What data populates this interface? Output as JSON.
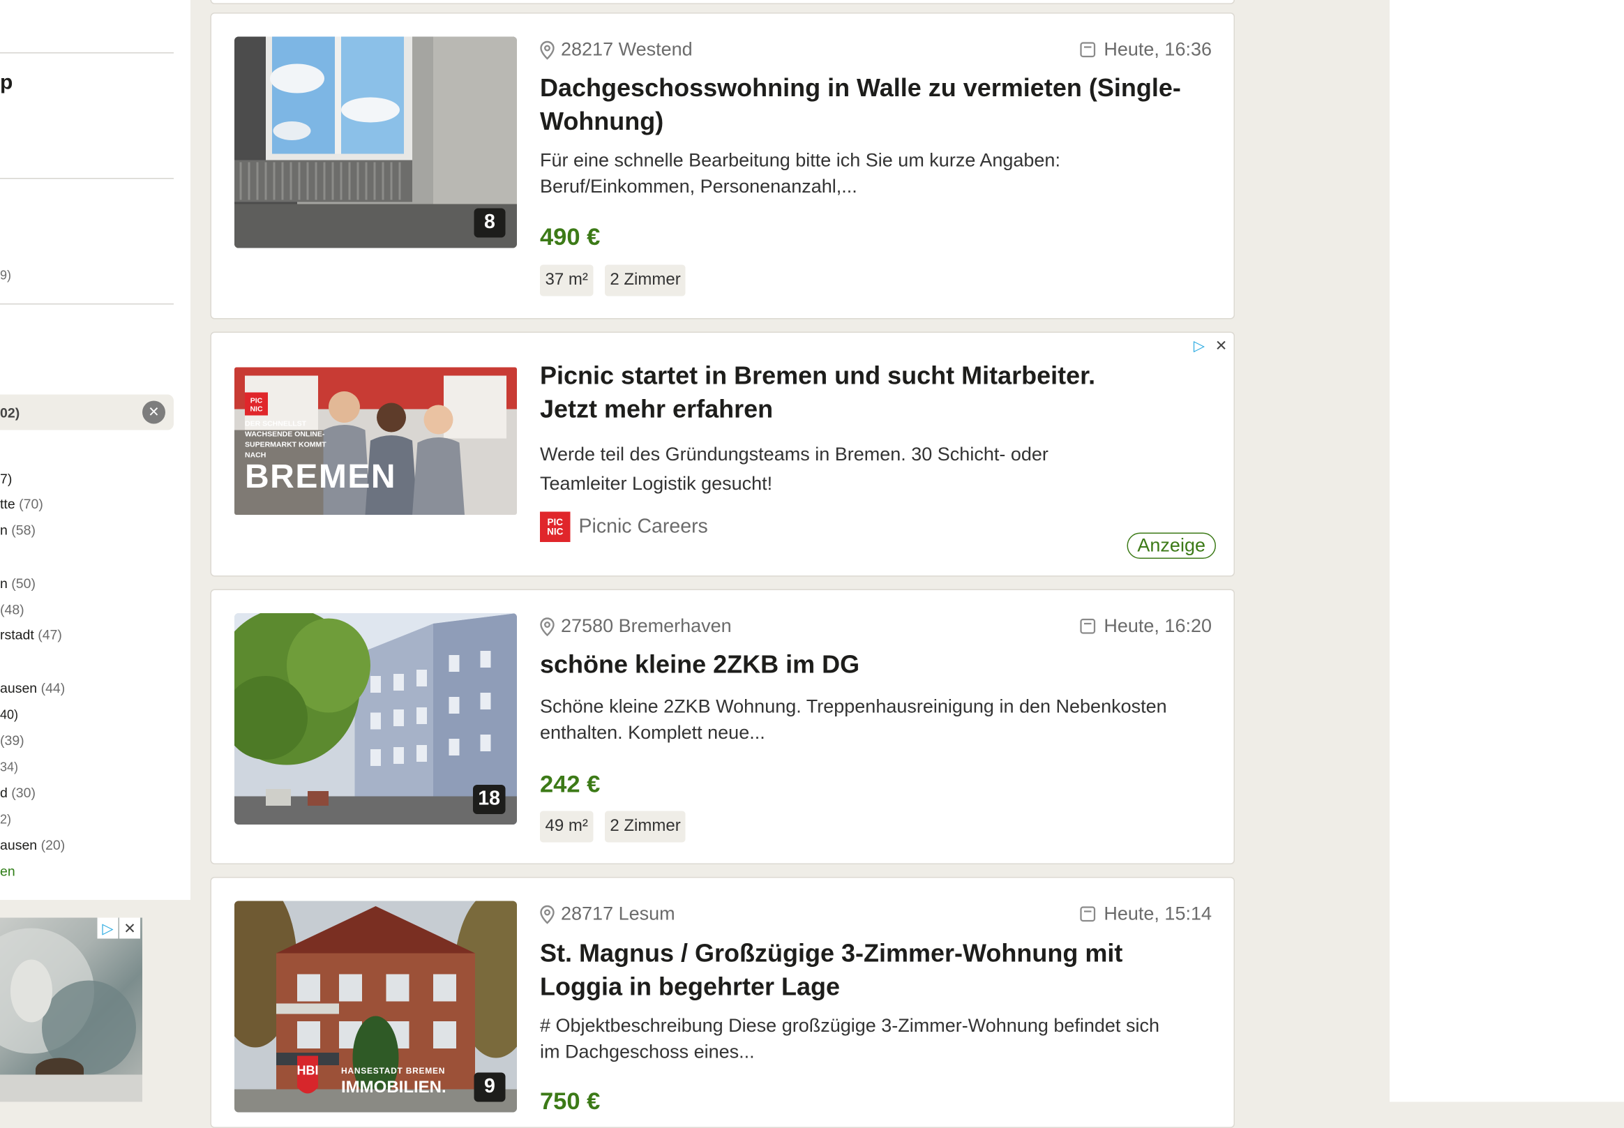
{
  "sidebar": {
    "top_fragment": "p",
    "frag_9": "9)",
    "chip_label": "02)",
    "chip_clear_icon": "×",
    "items": [
      {
        "label": "7)",
        "count": ""
      },
      {
        "label": "tte",
        "count": "(70)"
      },
      {
        "label": "n",
        "count": "(58)"
      },
      {
        "label": "n",
        "count": "(50)"
      },
      {
        "label": "",
        "count": "(48)"
      },
      {
        "label": "rstadt",
        "count": "(47)"
      },
      {
        "label": "ausen",
        "count": "(44)"
      },
      {
        "label": "40)",
        "count": ""
      },
      {
        "label": "(39)",
        "count": ""
      },
      {
        "label": "34)",
        "count": ""
      },
      {
        "label": "d",
        "count": "(30)"
      },
      {
        "label": "2)",
        "count": ""
      },
      {
        "label": "ausen",
        "count": "(20)"
      }
    ],
    "more_link": "en"
  },
  "ad_icons": {
    "adchoices": "▷",
    "close": "✕"
  },
  "listings": [
    {
      "location": "28217 Westend",
      "date": "Heute, 16:36",
      "title": "Dachgeschosswohning in Walle zu vermieten (Single-Wohnung)",
      "title_line1": "Dachgeschosswohning in Walle zu vermieten (Single-",
      "title_line2": "Wohnung)",
      "desc_line1": "Für eine schnelle Bearbeitung bitte ich Sie um kurze Angaben:",
      "desc_line2": "Beruf/Einkommen, Personenanzahl,...",
      "price": "490 €",
      "size": "37 m²",
      "rooms": "2 Zimmer",
      "image_count": "8"
    },
    {
      "location": "27580 Bremerhaven",
      "date": "Heute, 16:20",
      "title_line1": "schöne kleine 2ZKB im DG",
      "desc_line1": "Schöne kleine 2ZKB Wohnung. Treppenhausreinigung in den Nebenkosten",
      "desc_line2": "enthalten. Komplett neue...",
      "price": "242 €",
      "size": "49 m²",
      "rooms": "2 Zimmer",
      "image_count": "18"
    },
    {
      "location": "28717 Lesum",
      "date": "Heute, 15:14",
      "title_line1": "St. Magnus / Großzügige 3-Zimmer-Wohnung mit",
      "title_line2": "Loggia in begehrter Lage",
      "desc_line1": "# Objektbeschreibung Diese großzügige 3-Zimmer-Wohnung befindet sich",
      "desc_line2": "im Dachgeschoss eines...",
      "price": "750 €",
      "image_count": "9",
      "image_logo_small": "HANSESTADT BREMEN",
      "image_logo_big": "IMMOBILIEN."
    }
  ],
  "ad": {
    "title_line1": "Picnic startet in Bremen und sucht Mitarbeiter.",
    "title_line2": "Jetzt mehr erfahren",
    "desc_line1": "Werde teil des Gründungsteams in Bremen. 30 Schicht- oder",
    "desc_line2": "Teamleiter Logistik gesucht!",
    "brand": "Picnic Careers",
    "brand_logo_top": "PIC",
    "brand_logo_bottom": "NIC",
    "badge": "Anzeige",
    "image_text_small": "DER SCHNELLST WACHSENDE ONLINE-SUPERMARKT KOMMT NACH",
    "image_text_big": "BREMEN"
  }
}
